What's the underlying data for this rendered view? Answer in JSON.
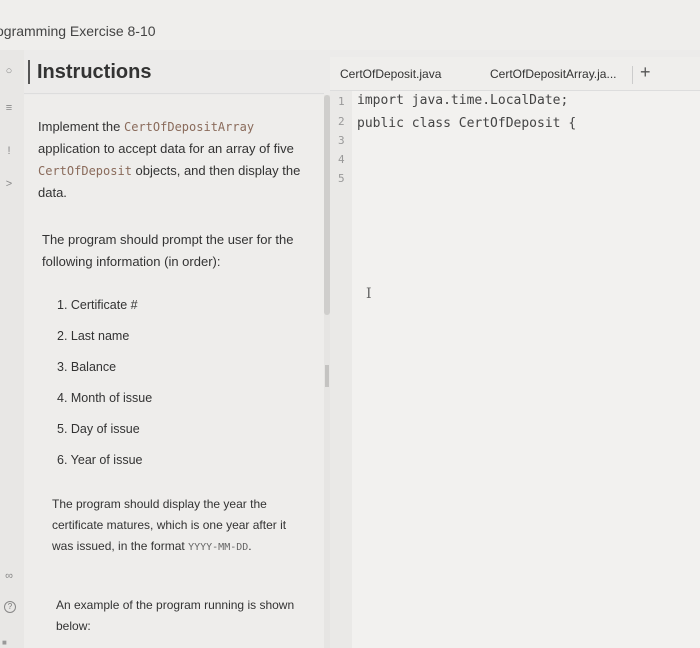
{
  "exercise": {
    "title": "ogramming Exercise 8-10"
  },
  "instructions": {
    "title": "Instructions",
    "intro_pre": "Implement the ",
    "intro_code1": "CertOfDepositArray",
    "intro_mid": " application to accept data for an array of five ",
    "intro_code2": "CertOfDeposit",
    "intro_post": " objects, and then display the data.",
    "prompt_text": "The program should prompt the user for the following information (in order):",
    "fields": [
      "1. Certificate #",
      "2. Last name",
      "3. Balance",
      "4. Month of issue",
      "5. Day of issue",
      "6. Year of issue"
    ],
    "display_text": "The program should display the year the certificate matures, which is one year after it was issued, in the format",
    "format_code": "YYYY-MM-DD",
    "format_post": ".",
    "example_text": "An example of the program running is shown below:"
  },
  "editor": {
    "tabs": [
      "CertOfDeposit.java",
      "CertOfDepositArray.ja..."
    ],
    "add_tab_label": "+",
    "line_numbers": [
      "1",
      "2",
      "3",
      "4",
      "5"
    ],
    "code_lines": [
      "import java.time.LocalDate;",
      "public class CertOfDeposit {",
      "",
      "",
      ""
    ]
  },
  "icons": {
    "rail": [
      "chevron-left-icon",
      "list-icon",
      "info-icon",
      "chevron-right-icon",
      "share-icon",
      "help-icon"
    ]
  }
}
